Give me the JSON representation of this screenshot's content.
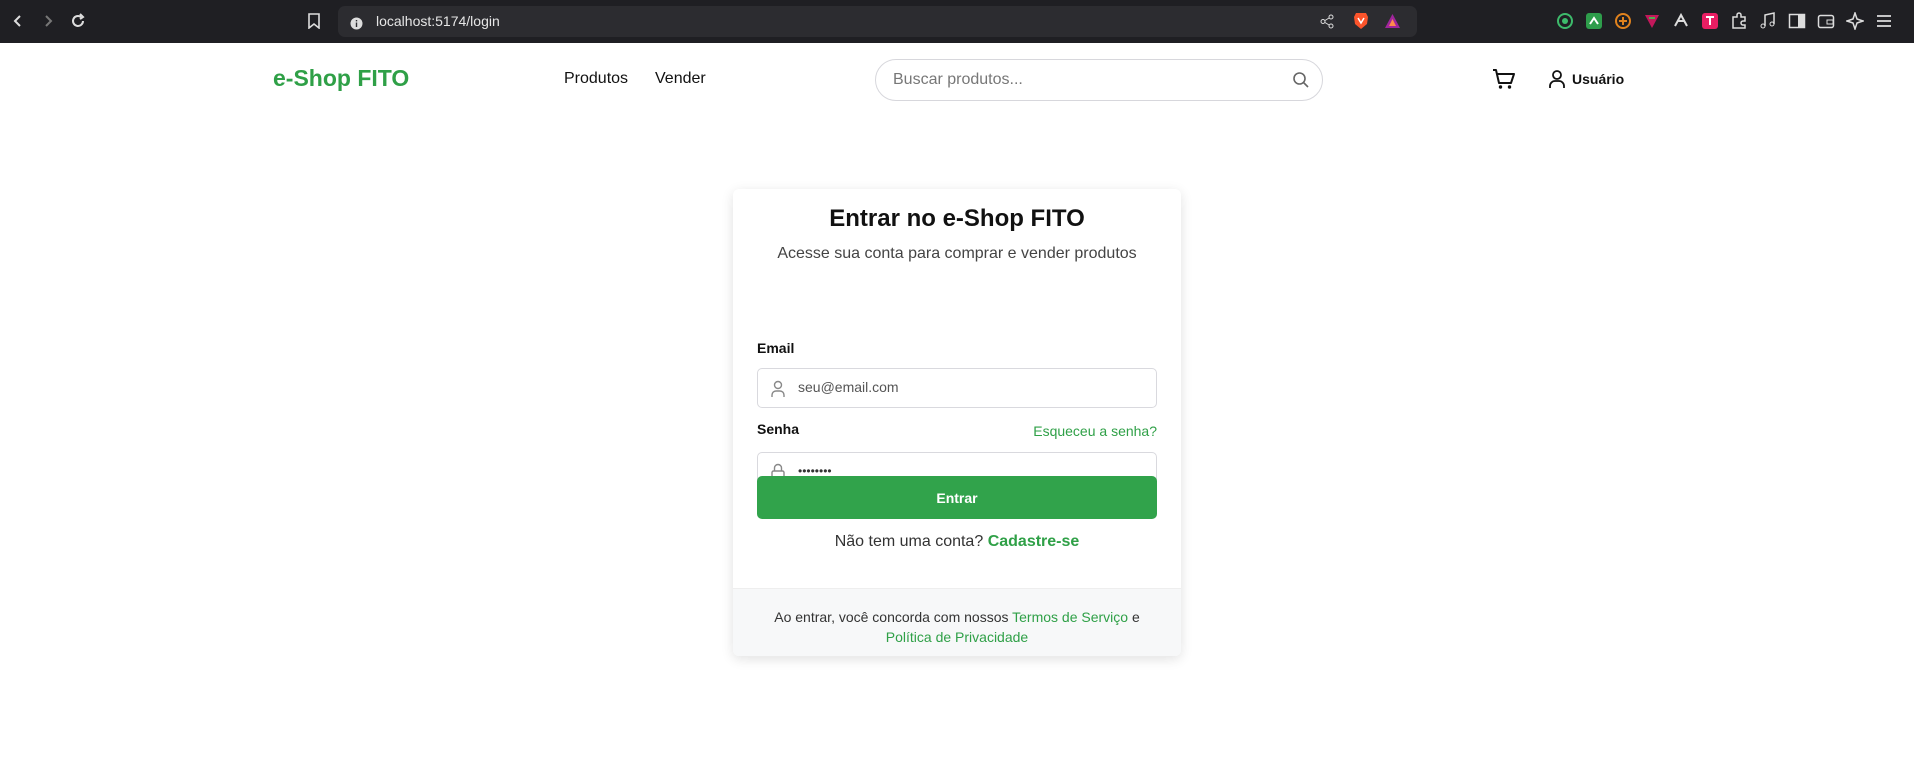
{
  "browser": {
    "url": "localhost:5174/login"
  },
  "header": {
    "logo": "e-Shop FITO",
    "nav": [
      "Produtos",
      "Vender"
    ],
    "search_placeholder": "Buscar produtos...",
    "user_label": "Usuário"
  },
  "login": {
    "title": "Entrar no e-Shop FITO",
    "subtitle": "Acesse sua conta para comprar e vender produtos",
    "email_label": "Email",
    "email_placeholder": "seu@email.com",
    "password_label": "Senha",
    "forgot_link": "Esqueceu a senha?",
    "password_value": "••••••••",
    "submit_label": "Entrar",
    "no_account": "Não tem uma conta?",
    "signup_link": "Cadastre-se"
  },
  "footer": {
    "prefix": "Ao entrar, você concorda com nossos",
    "terms": "Termos de Serviço",
    "and": "e",
    "privacy": "Política de Privacidade"
  },
  "colors": {
    "accent": "#2fa047",
    "browser_bar": "#1f1f23"
  }
}
